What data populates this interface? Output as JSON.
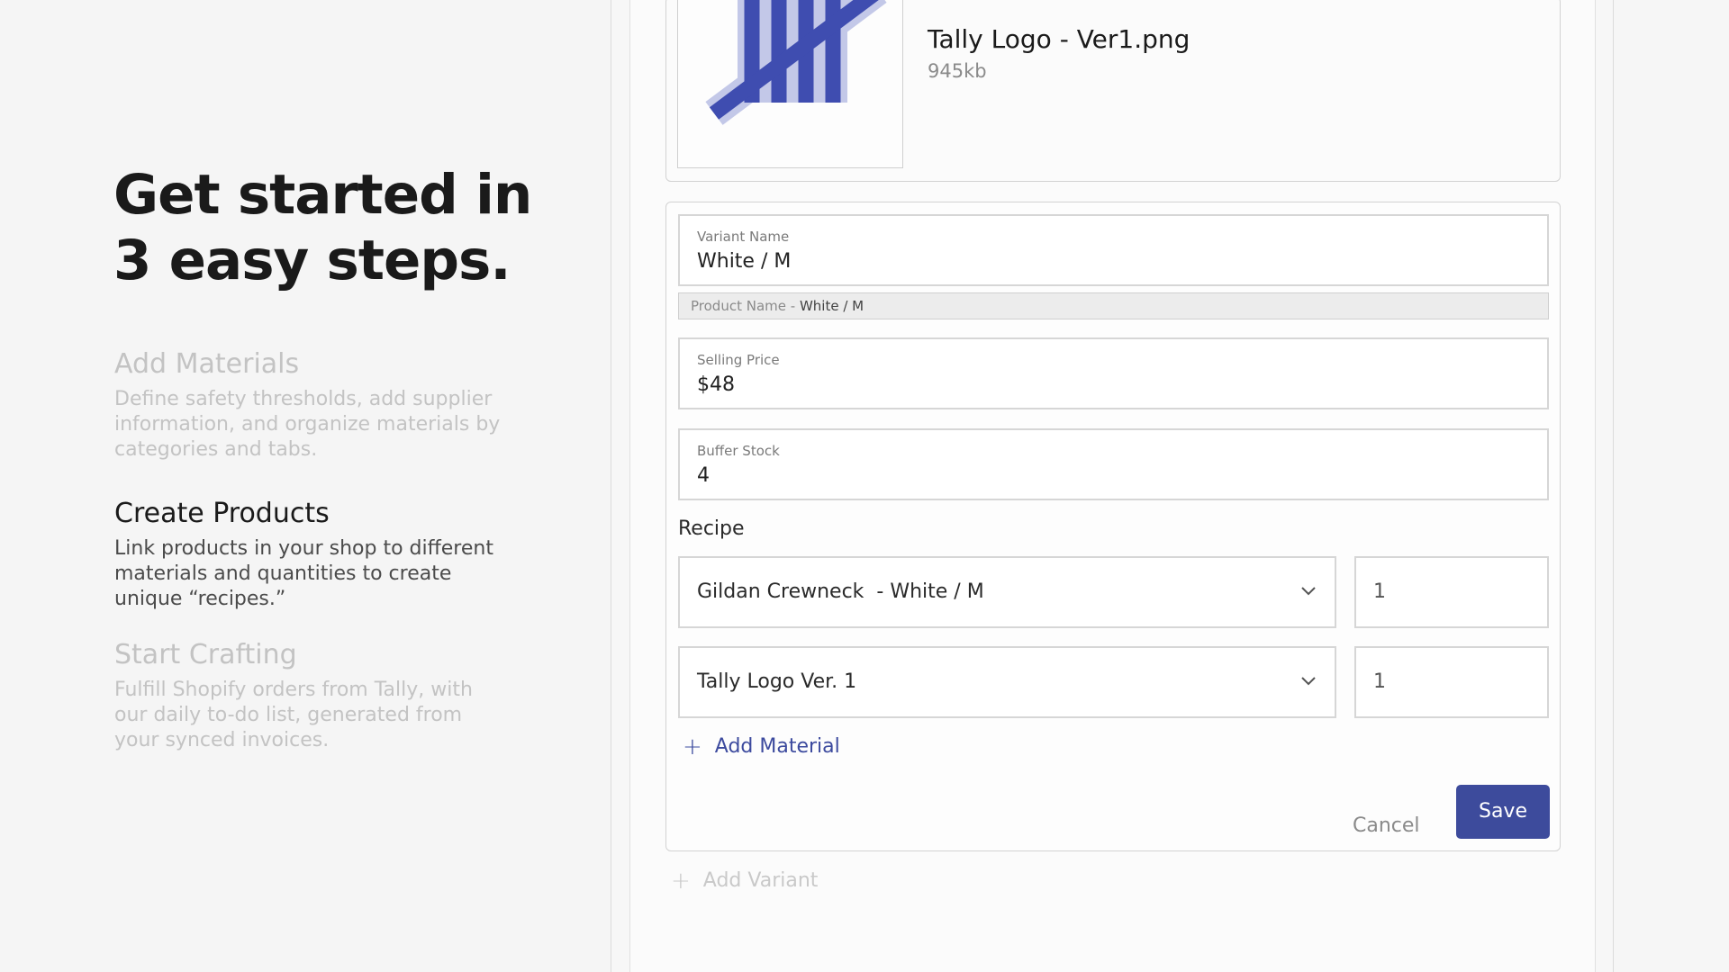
{
  "intro": {
    "headline_line1": "Get started in",
    "headline_line2": "3 easy steps.",
    "steps": [
      {
        "title": "Add Materials",
        "description": "Define safety thresholds, add supplier information, and organize materials by categories and tabs."
      },
      {
        "title": "Create Products",
        "description": "Link products in your shop to different materials and quantities to create unique “recipes.”"
      },
      {
        "title": "Start Crafting",
        "description": "Fulfill Shopify orders from Tally, with our daily to-do list, generated from your synced invoices."
      }
    ]
  },
  "file": {
    "name": "Tally Logo - Ver1.png",
    "size": "945kb",
    "thumb_icon": "tally-marks-logo"
  },
  "form": {
    "variant_name_label": "Variant Name",
    "variant_name_value": "White / M",
    "preview_prefix": "Product Name - ",
    "preview_value": "White / M",
    "selling_price_label": "Selling Price",
    "selling_price_value": "$48",
    "buffer_stock_label": "Buffer Stock",
    "buffer_stock_value": "4",
    "recipe_label": "Recipe",
    "recipe": [
      {
        "material": "Gildan Crewneck  - White / M",
        "quantity": "1"
      },
      {
        "material": "Tally Logo Ver. 1",
        "quantity": "1"
      }
    ],
    "add_material_label": "Add Material",
    "cancel_label": "Cancel",
    "save_label": "Save"
  },
  "add_variant_label": "Add Variant",
  "colors": {
    "accent": "#3d4b9c",
    "logo": "#3f4db0",
    "logo_outline": "#c3c8e8"
  }
}
